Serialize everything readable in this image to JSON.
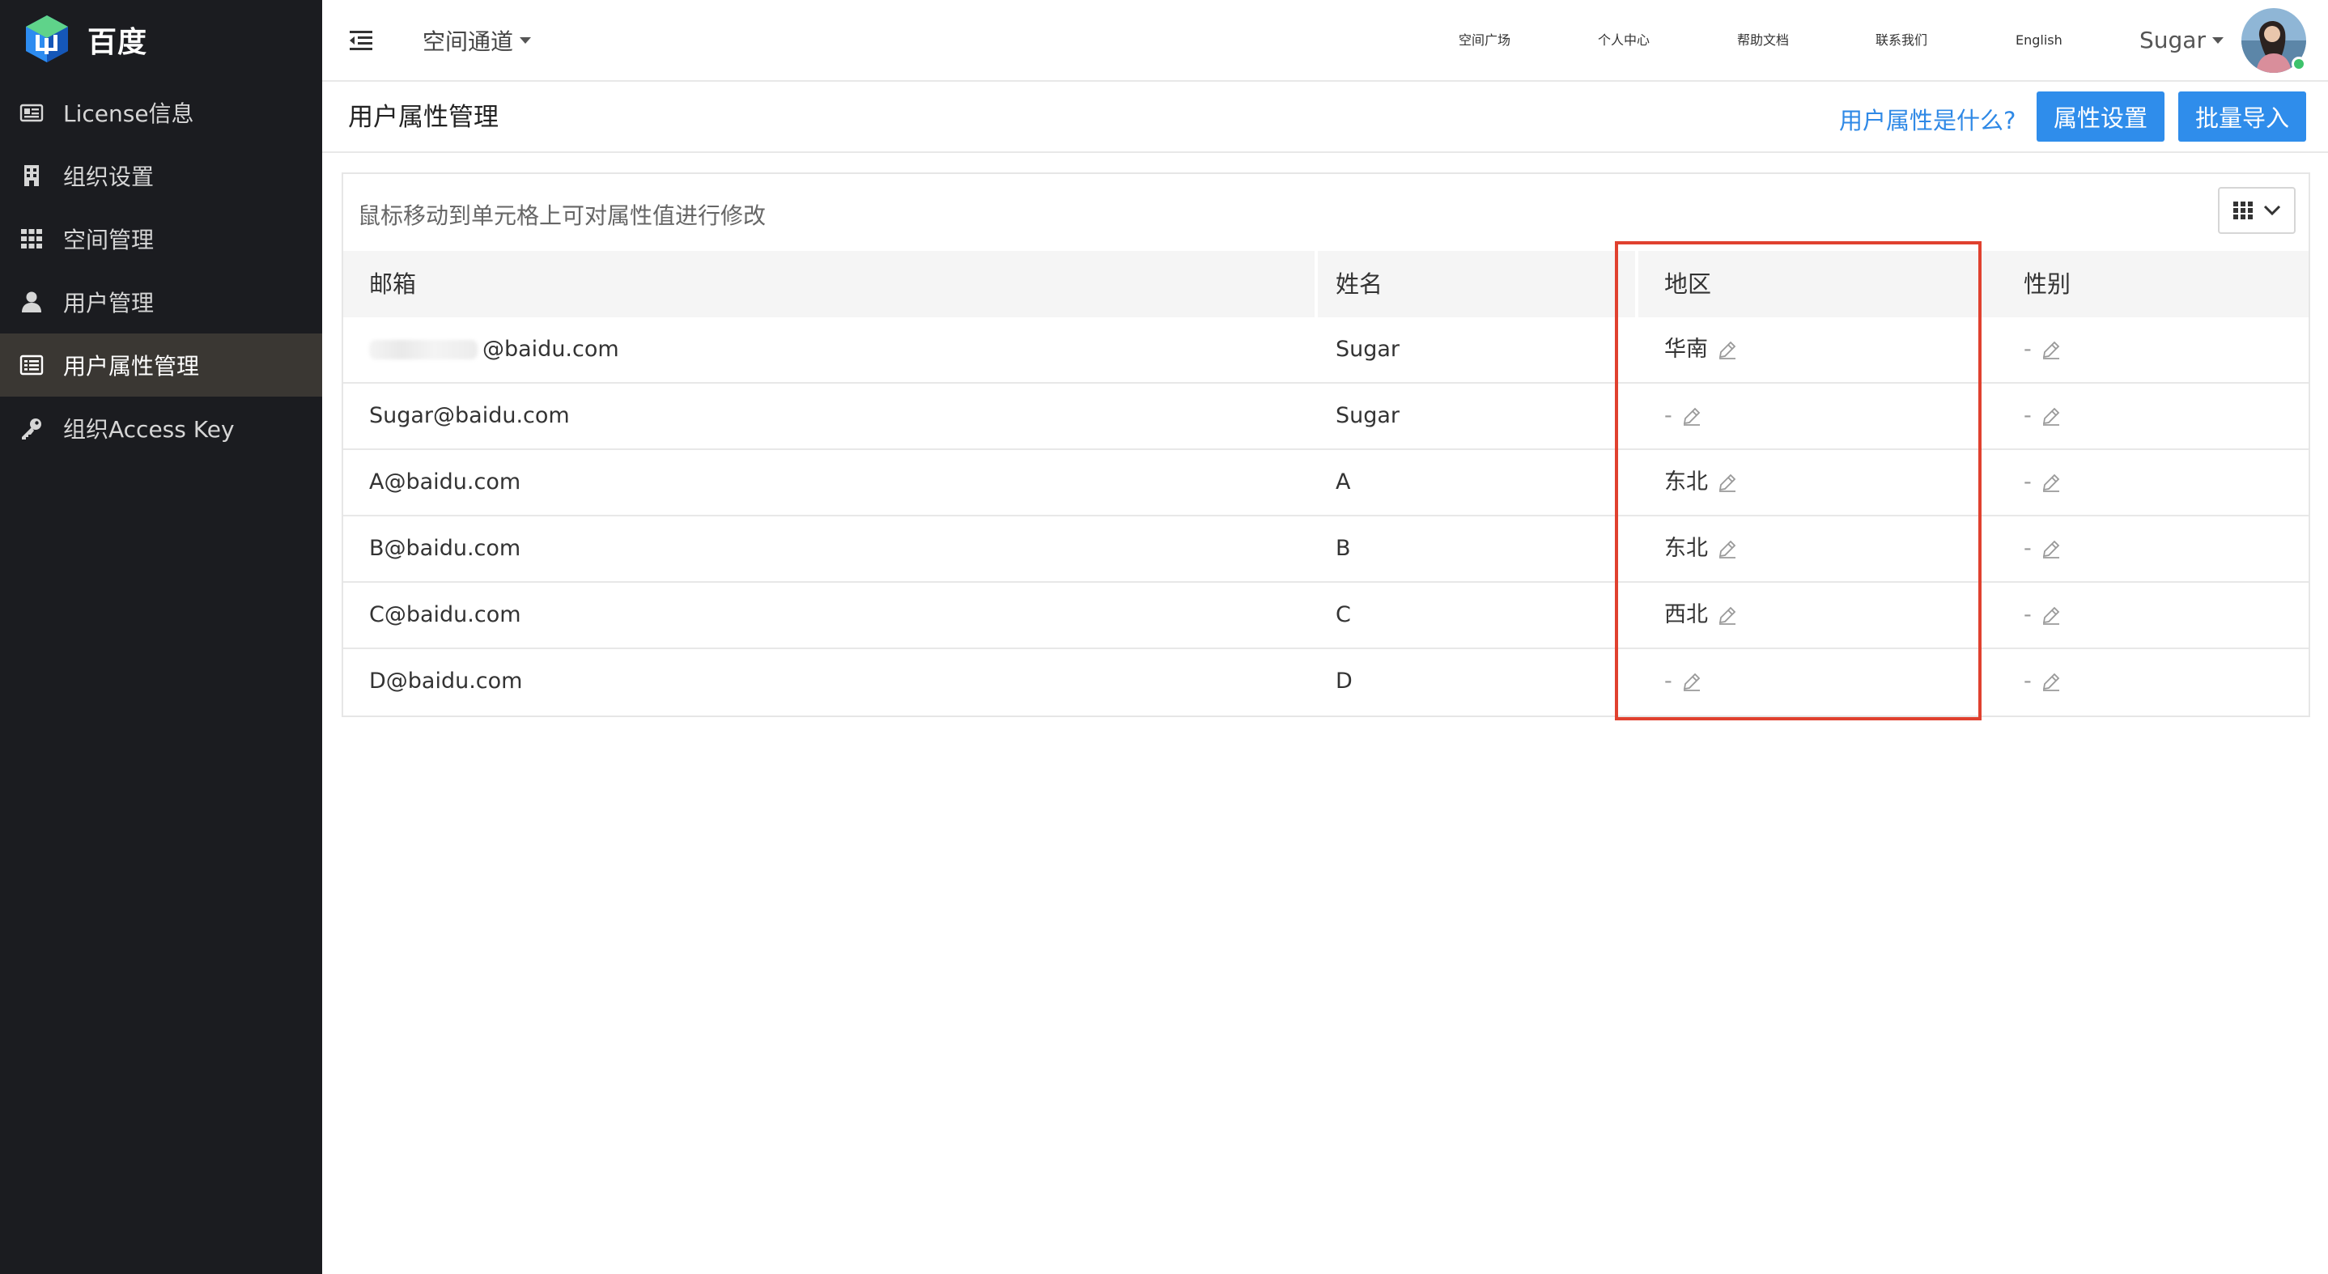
{
  "brand": {
    "name": "百度"
  },
  "sidebar": {
    "items": [
      {
        "label": "License信息",
        "icon": "id-card-icon",
        "active": false
      },
      {
        "label": "组织设置",
        "icon": "building-icon",
        "active": false
      },
      {
        "label": "空间管理",
        "icon": "grid-icon",
        "active": false
      },
      {
        "label": "用户管理",
        "icon": "user-icon",
        "active": false
      },
      {
        "label": "用户属性管理",
        "icon": "list-icon",
        "active": true
      },
      {
        "label": "组织Access Key",
        "icon": "key-icon",
        "active": false
      }
    ]
  },
  "topbar": {
    "channel_label": "空间通道",
    "nav": [
      "空间广场",
      "个人中心",
      "帮助文档",
      "联系我们",
      "English"
    ],
    "user_name": "Sugar"
  },
  "page": {
    "title": "用户属性管理",
    "help_link": "用户属性是什么?",
    "settings_button": "属性设置",
    "import_button": "批量导入"
  },
  "table": {
    "hint": "鼠标移动到单元格上可对属性值进行修改",
    "columns": [
      "邮箱",
      "姓名",
      "地区",
      "性别"
    ],
    "rows": [
      {
        "email": "@baidu.com",
        "email_obscured": true,
        "name": "Sugar",
        "region": "华南",
        "gender": "-"
      },
      {
        "email": "Sugar@baidu.com",
        "email_obscured": false,
        "name": "Sugar",
        "region": "-",
        "gender": "-"
      },
      {
        "email": "A@baidu.com",
        "email_obscured": false,
        "name": "A",
        "region": "东北",
        "gender": "-"
      },
      {
        "email": "B@baidu.com",
        "email_obscured": false,
        "name": "B",
        "region": "东北",
        "gender": "-"
      },
      {
        "email": "C@baidu.com",
        "email_obscured": false,
        "name": "C",
        "region": "西北",
        "gender": "-"
      },
      {
        "email": "D@baidu.com",
        "email_obscured": false,
        "name": "D",
        "region": "-",
        "gender": "-"
      }
    ]
  },
  "colors": {
    "sidebar_bg": "#1b1c20",
    "sidebar_active_bg": "#3a3733",
    "primary": "#2f8deb",
    "link": "#2f89e6",
    "highlight_border": "#e0412f"
  }
}
